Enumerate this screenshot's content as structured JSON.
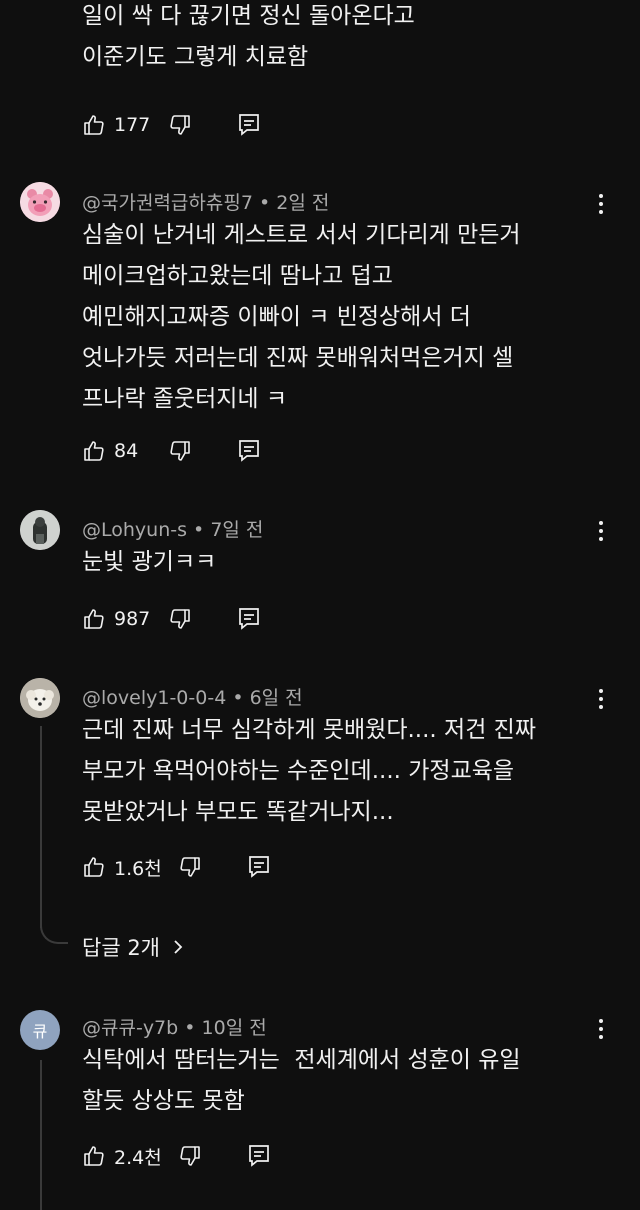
{
  "comments": [
    {
      "author": "",
      "age": "",
      "lines": [
        "일이 싹 다 끊기면 정신 돌아온다고",
        "이준기도 그렇게 치료함"
      ],
      "likes": "177"
    },
    {
      "author": "@국가권력급하츄핑7",
      "age": "2일 전",
      "lines": [
        "심술이 난거네 게스트로 서서 기다리게 만든거",
        "메이크업하고왔는데 땀나고 덥고",
        "예민해지고짜증 이빠이 ㅋ 빈정상해서 더",
        "엇나가듯 저러는데 진짜 못배워처먹은거지 셀",
        "프나락 졸웃터지네 ㅋ"
      ],
      "likes": "84"
    },
    {
      "author": "@Lohyun-s",
      "age": "7일 전",
      "lines": [
        "눈빛 광기ㅋㅋ"
      ],
      "likes": "987"
    },
    {
      "author": "@lovely1-0-0-4",
      "age": "6일 전",
      "lines": [
        "근데 진짜 너무 심각하게 못배웠다.... 저건 진짜",
        "부모가 욕먹어야하는 수준인데.... 가정교육을",
        "못받았거나 부모도 똑같거나지..."
      ],
      "likes": "1.6천",
      "replies_label": "답글 2개"
    },
    {
      "author": "@큐큐-y7b",
      "age": "10일 전",
      "avatar_text": "큐",
      "lines": [
        "식탁에서 땀터는거는  전세계에서 성훈이 유일",
        "할듯 상상도 못함"
      ],
      "likes": "2.4천"
    }
  ],
  "meta_separator": " • ",
  "icons": {
    "like": "thumbs-up-icon",
    "dislike": "thumbs-down-icon",
    "reply": "reply-comment-icon",
    "more": "more-vertical-icon",
    "chevron": "chevron-right-icon"
  },
  "colors": {
    "background": "#0f0f0f",
    "text": "#f1f1f1",
    "secondary": "#aaaaaa",
    "thread": "#3a3a3a",
    "avatar_letter_bg": "#8fa3bf"
  }
}
